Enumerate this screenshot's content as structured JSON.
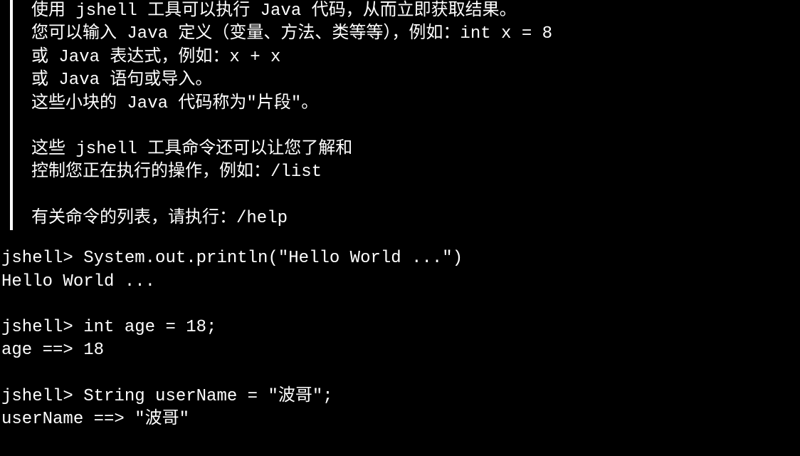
{
  "intro": {
    "lines": [
      "使用 jshell 工具可以执行 Java 代码，从而立即获取结果。",
      "您可以输入 Java 定义（变量、方法、类等等），例如：int x = 8",
      "或 Java 表达式，例如：x + x",
      "或 Java 语句或导入。",
      "这些小块的 Java 代码称为\"片段\"。",
      "",
      "这些 jshell 工具命令还可以让您了解和",
      "控制您正在执行的操作，例如：/list",
      "",
      "有关命令的列表，请执行：/help"
    ]
  },
  "session": {
    "prompt": "jshell> ",
    "entries": [
      {
        "command": "System.out.println(\"Hello World ...\")",
        "output": "Hello World ..."
      },
      {
        "command": "int age = 18;",
        "output": "age ==> 18"
      },
      {
        "command": "String userName = \"波哥\";",
        "output": "userName ==> \"波哥\""
      }
    ]
  }
}
